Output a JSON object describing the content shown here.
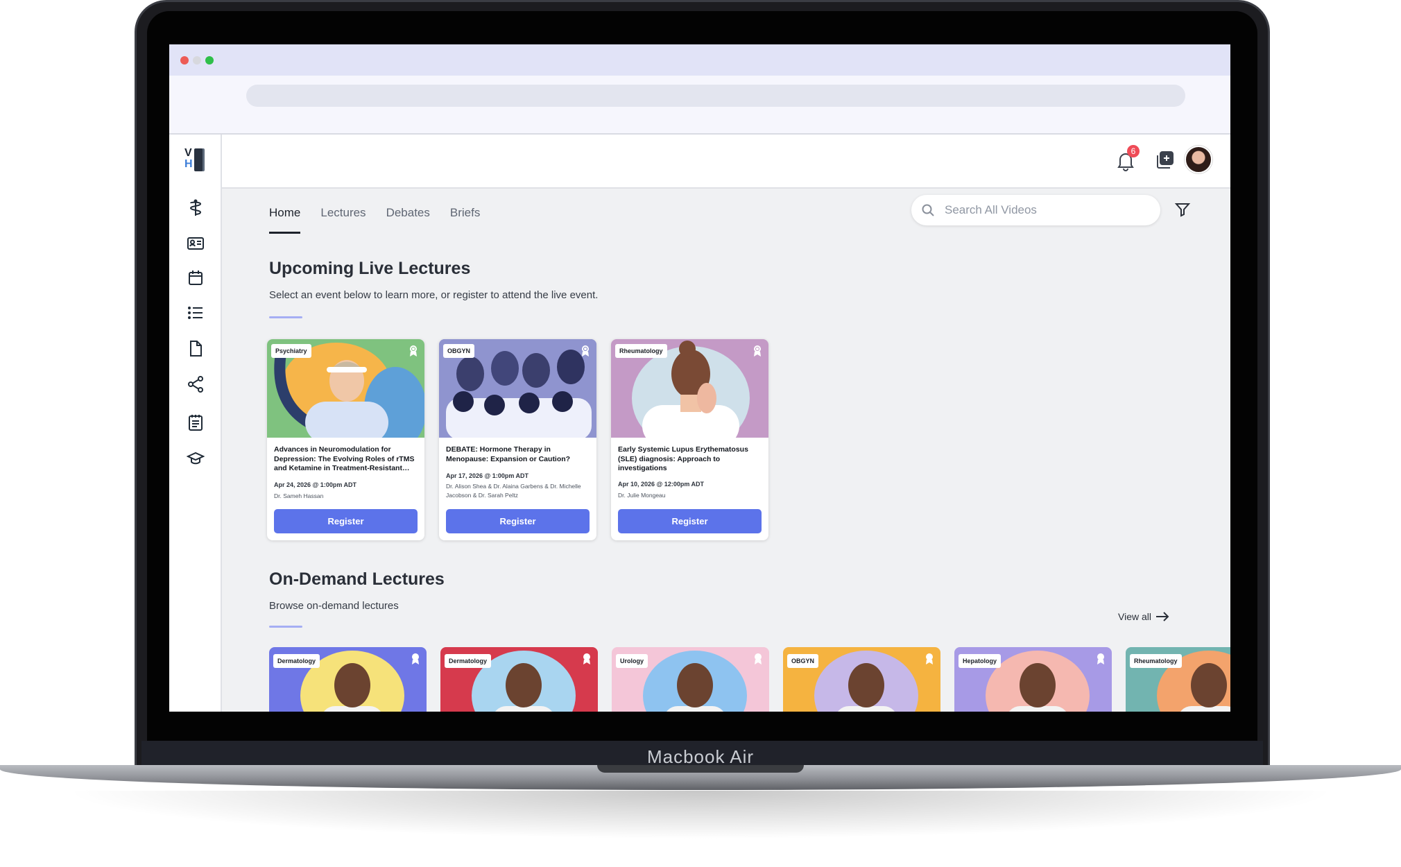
{
  "device": {
    "label": "Macbook Air"
  },
  "browser": {
    "traffic_colors": [
      "#ed5b56",
      "#d7d8de",
      "#2fbf4a"
    ]
  },
  "sidebar": {
    "logo_letters": [
      "V",
      "H"
    ],
    "items": [
      {
        "icon": "caduceus-icon"
      },
      {
        "icon": "id-card-icon"
      },
      {
        "icon": "calendar-icon"
      },
      {
        "icon": "list-icon"
      },
      {
        "icon": "document-icon"
      },
      {
        "icon": "share-icon"
      },
      {
        "icon": "notes-icon"
      },
      {
        "icon": "graduation-cap-icon"
      }
    ]
  },
  "header": {
    "notification_count": "6"
  },
  "nav": {
    "tabs": [
      "Home",
      "Lectures",
      "Debates",
      "Briefs"
    ],
    "active": "Home"
  },
  "search": {
    "placeholder": "Search All Videos"
  },
  "upcoming": {
    "title": "Upcoming Live Lectures",
    "subtitle": "Select an event below to learn more, or register to attend the live event.",
    "cards": [
      {
        "category": "Psychiatry",
        "title": "Advances in Neuromodulation for Depression: The Evolving Roles of rTMS and Ketamine in Treatment-Resistant…",
        "date": "Apr 24, 2026 @ 1:00pm ADT",
        "speakers": "Dr. Sameh Hassan",
        "button": "Register",
        "bg": "#7fc27f"
      },
      {
        "category": "OBGYN",
        "title": "DEBATE: Hormone Therapy in Menopause: Expansion or Caution?",
        "date": "Apr 17, 2026 @ 1:00pm ADT",
        "speakers": "Dr. Alison Shea & Dr. Alaina Garbens & Dr. Michelle Jacobson & Dr. Sarah Peltz",
        "button": "Register",
        "bg": "#7c81c2"
      },
      {
        "category": "Rheumatology",
        "title": "Early Systemic Lupus Erythematosus (SLE) diagnosis: Approach to investigations",
        "date": "Apr 10, 2026 @ 12:00pm ADT",
        "speakers": "Dr. Julie Mongeau",
        "button": "Register",
        "bg": "#c49ac6"
      }
    ]
  },
  "ondemand": {
    "title": "On-Demand Lectures",
    "subtitle": "Browse on-demand lectures",
    "view_all": "View all",
    "cards": [
      {
        "category": "Dermatology",
        "bg": "#6f77e6",
        "accent": "#f6e27a"
      },
      {
        "category": "Dermatology",
        "bg": "#d63a4d",
        "accent": "#a9d5f0"
      },
      {
        "category": "Urology",
        "bg": "#f4c6d8",
        "accent": "#8ec3f0"
      },
      {
        "category": "OBGYN",
        "bg": "#f5b340",
        "accent": "#c6b8e8"
      },
      {
        "category": "Hepatology",
        "bg": "#a79ae6",
        "accent": "#f5b8b0"
      },
      {
        "category": "Rheumatology",
        "bg": "#72b4b0",
        "accent": "#f3a36c"
      }
    ]
  }
}
